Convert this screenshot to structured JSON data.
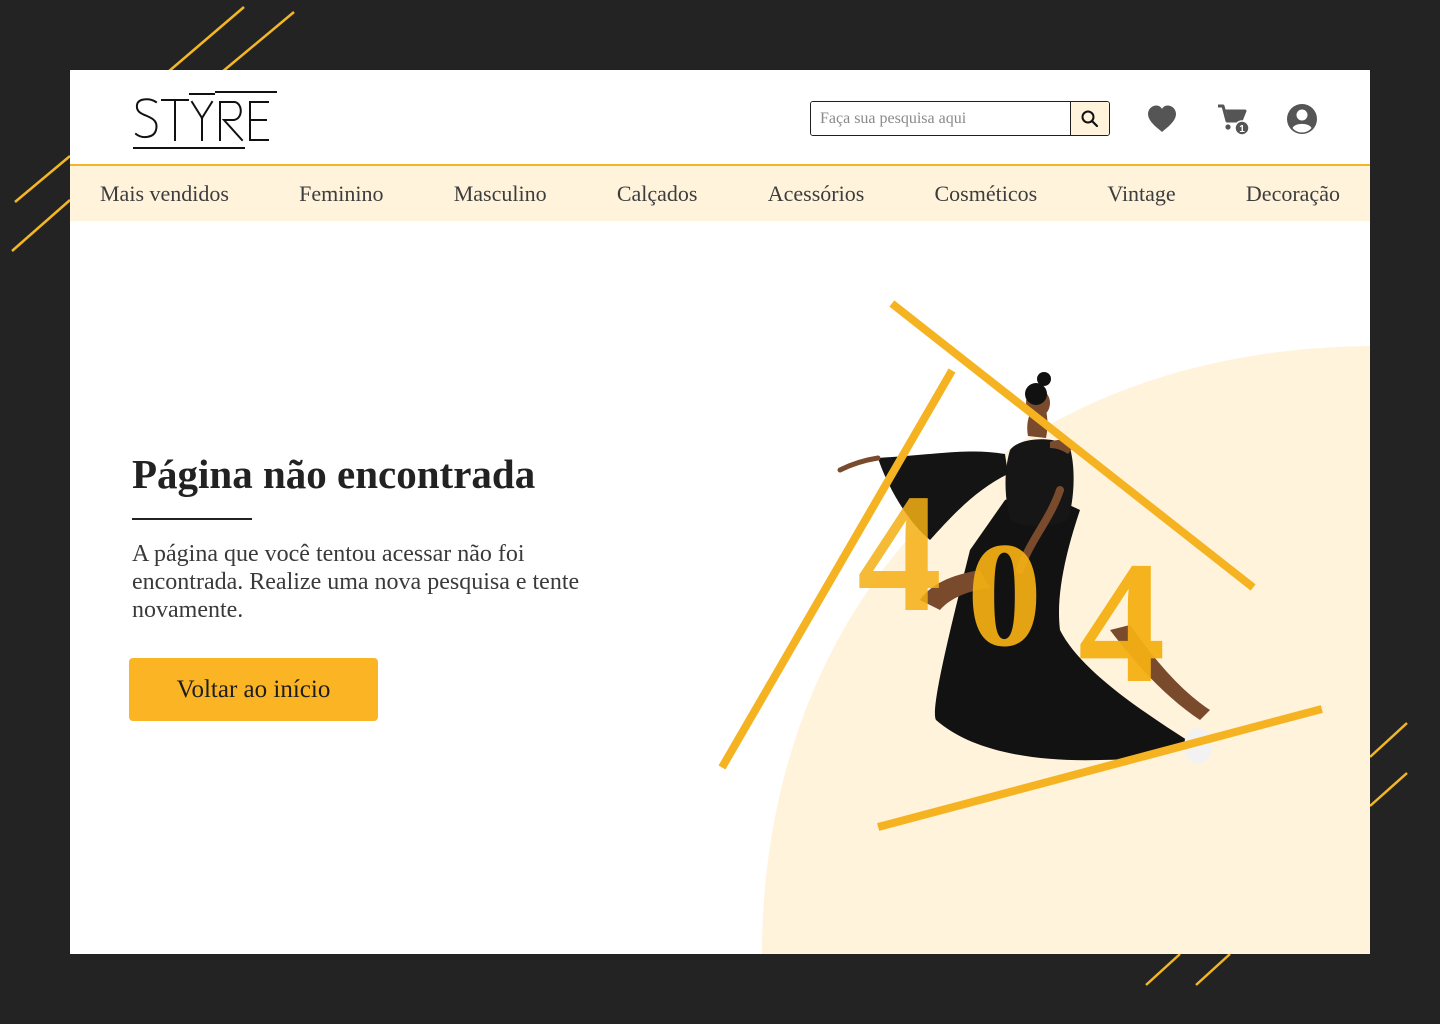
{
  "brand": {
    "logo_text": "STŸRE"
  },
  "search": {
    "placeholder": "Faça sua pesquisa aqui"
  },
  "header_icons": [
    "search-icon",
    "heart-icon",
    "cart-icon",
    "user-icon"
  ],
  "cart": {
    "badge_count": "1"
  },
  "nav": {
    "items": [
      "Mais vendidos",
      "Feminino",
      "Masculino",
      "Calçados",
      "Acessórios",
      "Cosméticos",
      "Vintage",
      "Decoração"
    ]
  },
  "error": {
    "title": "Página não encontrada",
    "description": "A página que você tentou acessar não foi encontrada. Realize uma nova pesquisa e tente novamente.",
    "code_digits": [
      "4",
      "0",
      "4"
    ],
    "button_label": "Voltar ao início"
  },
  "colors": {
    "background": "#232323",
    "accent": "#f4b724",
    "nav_bg": "#fff3dc",
    "text": "#222222"
  }
}
